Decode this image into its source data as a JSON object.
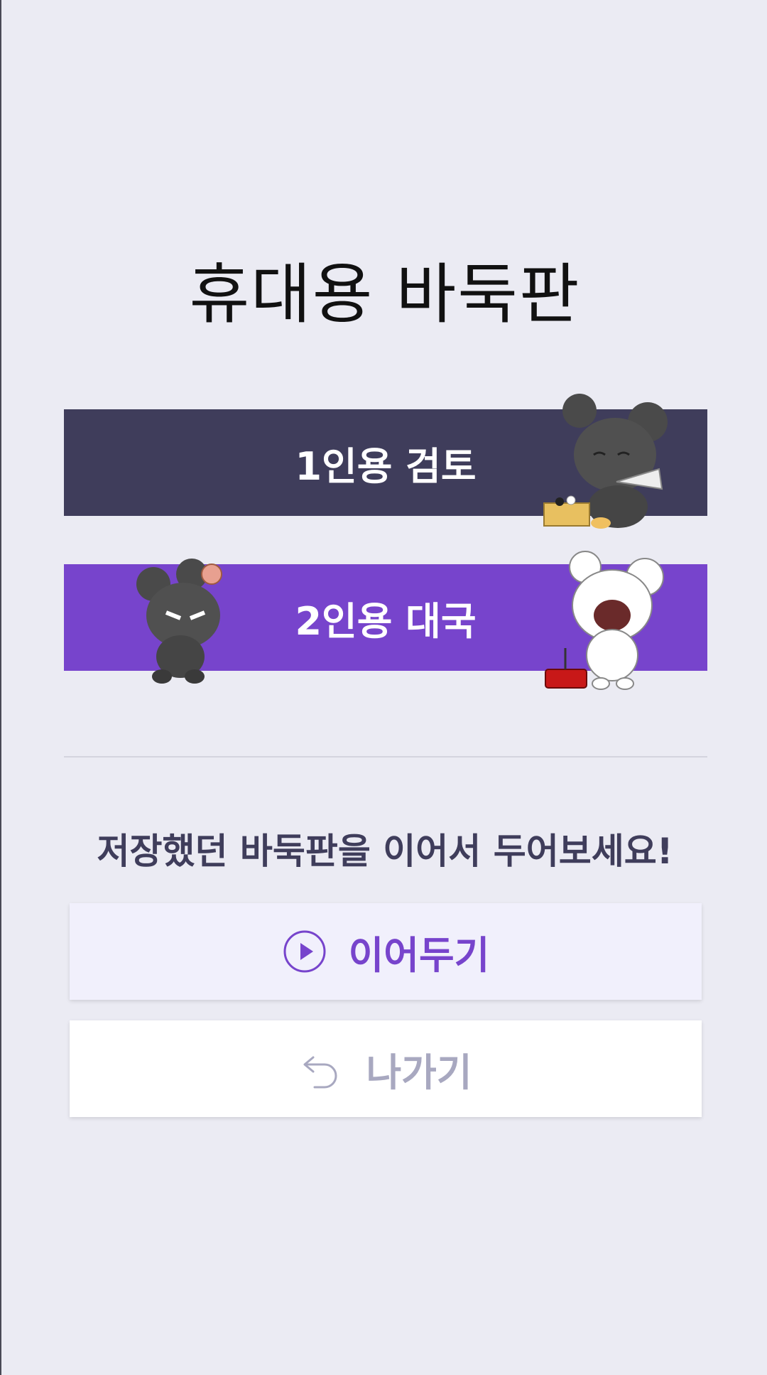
{
  "app": {
    "title": "휴대용 바둑판"
  },
  "modes": {
    "single_label": "1인용 검토",
    "duo_label": "2인용 대국"
  },
  "resume": {
    "message": "저장했던 바둑판을 이어서 두어보세요!",
    "continue_label": "이어두기",
    "exit_label": "나가기"
  },
  "icons": {
    "continue": "play-circle-icon",
    "exit": "undo-arrow-icon"
  },
  "colors": {
    "background": "#ebebf3",
    "single_button": "#3f3d5b",
    "duo_button": "#7744cc",
    "continue_button": "#f1f0fc",
    "continue_text": "#7744cc",
    "exit_button": "#ffffff",
    "exit_text": "#a8a8c0"
  }
}
